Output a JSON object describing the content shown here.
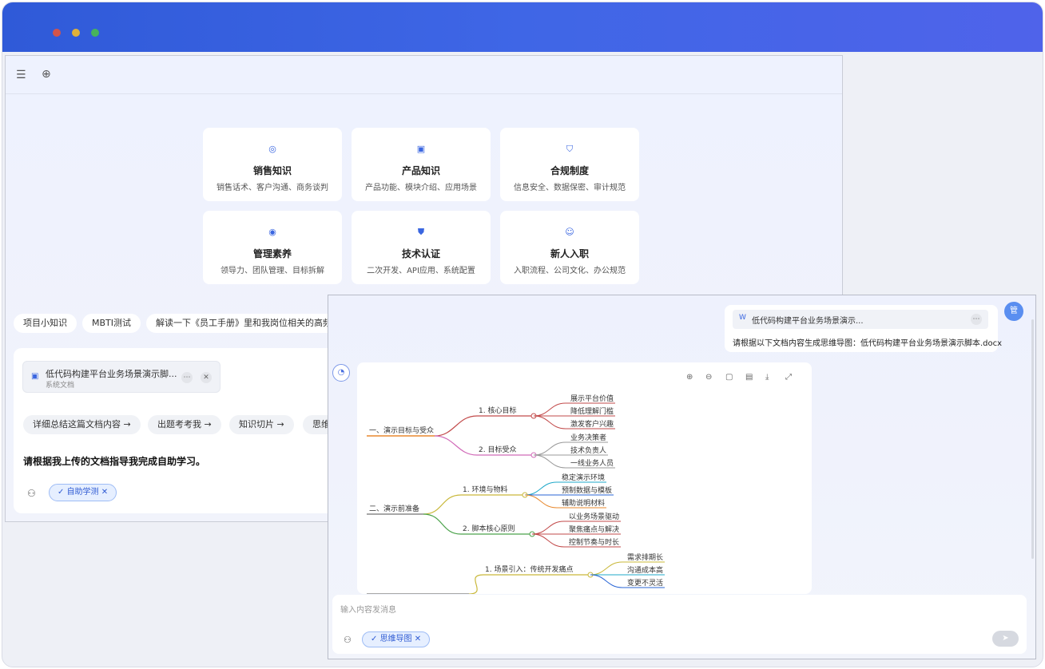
{
  "cards": [
    {
      "title": "销售知识",
      "desc": "销售话术、客户沟通、商务谈判",
      "icon": "search-doc-icon"
    },
    {
      "title": "产品知识",
      "desc": "产品功能、模块介绍、应用场景",
      "icon": "document-icon"
    },
    {
      "title": "合规制度",
      "desc": "信息安全、数据保密、审计规范",
      "icon": "shield-icon"
    },
    {
      "title": "管理素养",
      "desc": "领导力、团队管理、目标拆解",
      "icon": "target-icon"
    },
    {
      "title": "技术认证",
      "desc": "二次开发、API应用、系统配置",
      "icon": "shield-check-icon"
    },
    {
      "title": "新人入职",
      "desc": "入职流程、公司文化、办公规范",
      "icon": "user-icon"
    }
  ],
  "suggestions": [
    "项目小知识",
    "MBTI测试",
    "解读一下《员工手册》里和我岗位相关的高频规"
  ],
  "composer": {
    "file_name": "低代码构建平台业务场景演示脚...",
    "file_type": "系统文档",
    "quick_actions": [
      "详细总结这篇文档内容 →",
      "出题考考我 →",
      "知识切片 →",
      "思维"
    ],
    "prompt": "请根据我上传的文档指导我完成自助学习。",
    "tag": "自助学测"
  },
  "chat": {
    "user_file": "低代码构建平台业务场景演示...",
    "user_message": "请根据以下文档内容生成思维导图：低代码构建平台业务场景演示脚本.docx",
    "user_avatar": "管",
    "input_placeholder": "输入内容发消息",
    "tag": "思维导图"
  },
  "mindmap": {
    "sections": [
      {
        "label": "一、演示目标与受众",
        "branches": [
          {
            "label": "1. 核心目标",
            "leaves": [
              "展示平台价值",
              "降低理解门槛",
              "激发客户兴趣"
            ]
          },
          {
            "label": "2. 目标受众",
            "leaves": [
              "业务决策者",
              "技术负责人",
              "一线业务人员"
            ]
          }
        ]
      },
      {
        "label": "二、演示前准备",
        "branches": [
          {
            "label": "1. 环境与物料",
            "leaves": [
              "稳定演示环境",
              "预制数据与模板",
              "辅助说明材料"
            ]
          },
          {
            "label": "2. 脚本核心原则",
            "leaves": [
              "以业务场景驱动",
              "聚焦痛点与解决",
              "控制节奏与时长"
            ]
          }
        ]
      },
      {
        "label": "",
        "branches": [
          {
            "label": "1. 场景引入：传统开发痛点",
            "leaves": [
              "需求排期长",
              "沟通成本高",
              "变更不灵活"
            ]
          }
        ]
      }
    ]
  }
}
